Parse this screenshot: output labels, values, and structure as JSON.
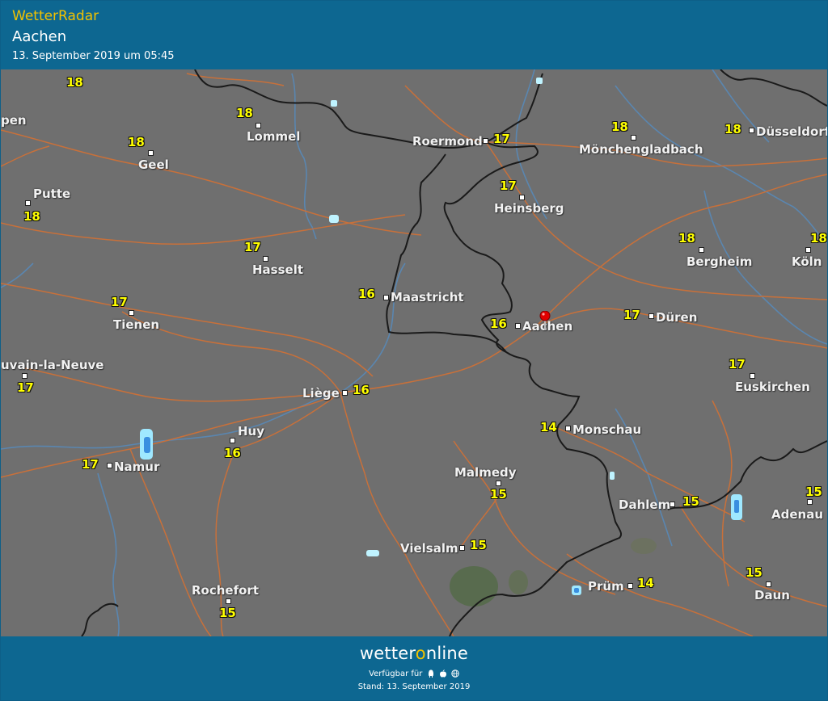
{
  "header": {
    "app_title": "WetterRadar",
    "location": "Aachen",
    "timestamp": "13. September 2019 um 05:45"
  },
  "colors": {
    "header_bg": "#0d6791",
    "title_yellow": "#f2c200",
    "map_bg": "#6f6f6f",
    "road": "#c8703a",
    "river": "#5a86b0",
    "border": "#1a1a1a",
    "temperature": "#ffff00",
    "marker": "#e00000"
  },
  "map": {
    "selected_location": "Aachen",
    "marker_icon": "location-pin-icon",
    "cities": [
      {
        "id": "lommel",
        "name": "Lommel"
      },
      {
        "id": "roermond",
        "name": "Roermond"
      },
      {
        "id": "moenchengladbach",
        "name": "Mönchengladbach"
      },
      {
        "id": "duesseldorf",
        "name": "Düsseldorf"
      },
      {
        "id": "geel",
        "name": "Geel"
      },
      {
        "id": "putte",
        "name": "Putte"
      },
      {
        "id": "heinsberg",
        "name": "Heinsberg"
      },
      {
        "id": "hasselt",
        "name": "Hasselt"
      },
      {
        "id": "bergheim",
        "name": "Bergheim"
      },
      {
        "id": "koeln",
        "name": "Köln"
      },
      {
        "id": "maastricht",
        "name": "Maastricht"
      },
      {
        "id": "tienen",
        "name": "Tienen"
      },
      {
        "id": "aachen",
        "name": "Aachen"
      },
      {
        "id": "dueren",
        "name": "Düren"
      },
      {
        "id": "louvain",
        "name": "uvain-la-Neuve"
      },
      {
        "id": "liege",
        "name": "Liège"
      },
      {
        "id": "euskirchen",
        "name": "Euskirchen"
      },
      {
        "id": "huy",
        "name": "Huy"
      },
      {
        "id": "monschau",
        "name": "Monschau"
      },
      {
        "id": "namur",
        "name": "Namur"
      },
      {
        "id": "malmedy",
        "name": "Malmedy"
      },
      {
        "id": "dahlem",
        "name": "Dahlem"
      },
      {
        "id": "adenau",
        "name": "Adenau"
      },
      {
        "id": "vielsalm",
        "name": "Vielsalm"
      },
      {
        "id": "pruem",
        "name": "Prüm"
      },
      {
        "id": "rochefort",
        "name": "Rochefort"
      },
      {
        "id": "daun",
        "name": "Daun"
      },
      {
        "id": "edge_left",
        "name": "pen"
      }
    ],
    "temperatures": [
      {
        "id": "t_edge_top",
        "value": "18"
      },
      {
        "id": "t_lommel",
        "value": "18"
      },
      {
        "id": "t_roermond",
        "value": "17"
      },
      {
        "id": "t_moenchengladbach",
        "value": "18"
      },
      {
        "id": "t_duesseldorf",
        "value": "18"
      },
      {
        "id": "t_geel",
        "value": "18"
      },
      {
        "id": "t_putte",
        "value": "18"
      },
      {
        "id": "t_heinsberg",
        "value": "17"
      },
      {
        "id": "t_hasselt",
        "value": "17"
      },
      {
        "id": "t_bergheim",
        "value": "18"
      },
      {
        "id": "t_koeln",
        "value": "18"
      },
      {
        "id": "t_maastricht",
        "value": "16"
      },
      {
        "id": "t_tienen",
        "value": "17"
      },
      {
        "id": "t_aachen",
        "value": "16"
      },
      {
        "id": "t_dueren",
        "value": "17"
      },
      {
        "id": "t_louvain",
        "value": "17"
      },
      {
        "id": "t_liege",
        "value": "16"
      },
      {
        "id": "t_euskirchen",
        "value": "17"
      },
      {
        "id": "t_huy",
        "value": "16"
      },
      {
        "id": "t_monschau",
        "value": "14"
      },
      {
        "id": "t_namur",
        "value": "17"
      },
      {
        "id": "t_malmedy",
        "value": "15"
      },
      {
        "id": "t_dahlem",
        "value": "15"
      },
      {
        "id": "t_adenau",
        "value": "15"
      },
      {
        "id": "t_vielsalm",
        "value": "15"
      },
      {
        "id": "t_pruem",
        "value": "14"
      },
      {
        "id": "t_rochefort",
        "value": "15"
      },
      {
        "id": "t_daun",
        "value": "15"
      }
    ]
  },
  "footer": {
    "brand_prefix": "wetter",
    "brand_o": "o",
    "brand_suffix": "nline",
    "available_label": "Verfügbar für",
    "platform_icons": [
      "android-icon",
      "apple-icon",
      "web-icon"
    ],
    "stand_label": "Stand: 13. September 2019"
  }
}
